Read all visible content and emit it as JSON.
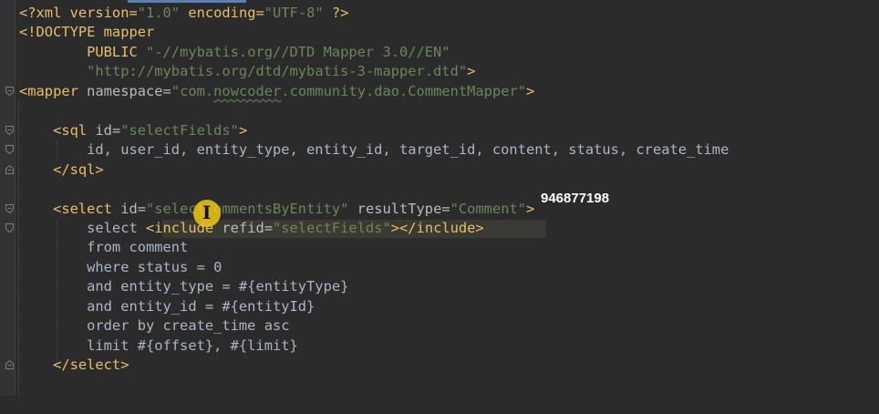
{
  "editor": {
    "lines": [
      [
        {
          "t": "<?xml version=",
          "c": "pi"
        },
        {
          "t": "\"1.0\"",
          "c": "val"
        },
        {
          "t": " encoding=",
          "c": "pi"
        },
        {
          "t": "\"UTF-8\"",
          "c": "val"
        },
        {
          "t": " ?>",
          "c": "pi"
        }
      ],
      [
        {
          "t": "<!DOCTYPE mapper",
          "c": "pi"
        }
      ],
      [
        {
          "t": "        PUBLIC ",
          "c": "pi"
        },
        {
          "t": "\"-//mybatis.org//DTD Mapper 3.0//EN\"",
          "c": "val"
        }
      ],
      [
        {
          "t": "        ",
          "c": "pi"
        },
        {
          "t": "\"http://mybatis.org/dtd/mybatis-3-mapper.dtd\"",
          "c": "val"
        },
        {
          "t": ">",
          "c": "pi"
        }
      ],
      [
        {
          "t": "<mapper ",
          "c": "tag"
        },
        {
          "t": "namespace=",
          "c": "attr"
        },
        {
          "t": "\"com.",
          "c": "val"
        },
        {
          "t": "nowcoder",
          "c": "val-sq"
        },
        {
          "t": ".community.dao.CommentMapper\"",
          "c": "val"
        },
        {
          "t": ">",
          "c": "tag"
        }
      ],
      [],
      [
        {
          "t": "    <sql ",
          "c": "tag"
        },
        {
          "t": "id=",
          "c": "attr"
        },
        {
          "t": "\"selectFields\"",
          "c": "val"
        },
        {
          "t": ">",
          "c": "tag"
        }
      ],
      [
        {
          "t": "        id, user_id, entity_type, entity_id, target_id, content, status, create_time",
          "c": "txt"
        }
      ],
      [
        {
          "t": "    </sql>",
          "c": "tag"
        }
      ],
      [],
      [
        {
          "t": "    <select ",
          "c": "tag"
        },
        {
          "t": "id=",
          "c": "attr"
        },
        {
          "t": "\"selectCommentsByEntity\"",
          "c": "val"
        },
        {
          "t": " resultType=",
          "c": "attr"
        },
        {
          "t": "\"Comment\"",
          "c": "val"
        },
        {
          "t": ">",
          "c": "tag"
        }
      ],
      [
        {
          "t": "        select ",
          "c": "txt"
        },
        {
          "t": "<include ",
          "c": "tag"
        },
        {
          "t": "refid=",
          "c": "attr"
        },
        {
          "t": "\"selectFields\"",
          "c": "val"
        },
        {
          "t": "></include>",
          "c": "tag"
        }
      ],
      [
        {
          "t": "        from comment",
          "c": "txt"
        }
      ],
      [
        {
          "t": "        where status = 0",
          "c": "txt"
        }
      ],
      [
        {
          "t": "        and entity_type = #{entityType}",
          "c": "txt"
        }
      ],
      [
        {
          "t": "        and entity_id = #{entityId}",
          "c": "txt"
        }
      ],
      [
        {
          "t": "        order by create_time asc",
          "c": "txt"
        }
      ],
      [
        {
          "t": "        limit #{offset}, #{limit}",
          "c": "txt"
        }
      ],
      [
        {
          "t": "    </select>",
          "c": "tag"
        }
      ],
      [],
      [
        {
          "t": "    ",
          "c": "txt"
        }
      ]
    ]
  },
  "overlay_number": "946877198",
  "colors": {
    "background": "#2b2b2b",
    "tag": "#e8bf6a",
    "attr": "#bababa",
    "value": "#6a8759",
    "text": "#a9b7c6",
    "include_highlight": "#3b3a32",
    "cursor_highlight": "#f0c814"
  }
}
